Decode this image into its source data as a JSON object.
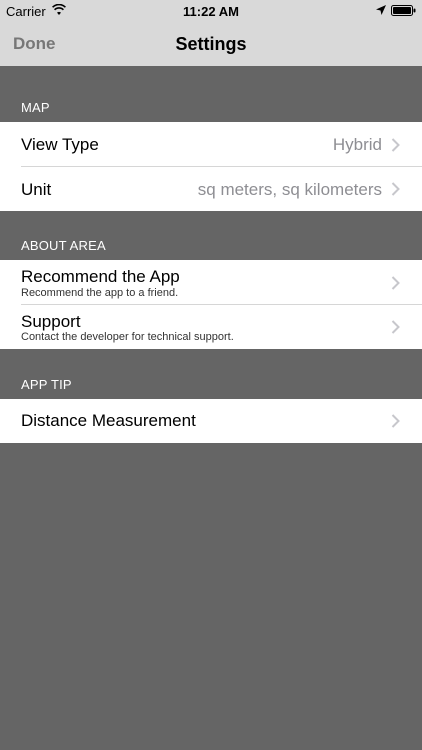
{
  "status_bar": {
    "carrier": "Carrier",
    "time": "11:22 AM"
  },
  "nav": {
    "done_label": "Done",
    "title": "Settings"
  },
  "sections": {
    "map": {
      "header": "MAP",
      "view_type": {
        "label": "View Type",
        "value": "Hybrid"
      },
      "unit": {
        "label": "Unit",
        "value": "sq meters, sq kilometers"
      }
    },
    "about": {
      "header": "ABOUT AREA",
      "recommend": {
        "label": "Recommend the App",
        "subtitle": "Recommend the app to a friend."
      },
      "support": {
        "label": "Support",
        "subtitle": "Contact the developer for technical support."
      }
    },
    "tip": {
      "header": "APP TIP",
      "distance": {
        "label": "Distance Measurement"
      }
    }
  },
  "colors": {
    "background": "#656565",
    "bar": "#d9d9d9",
    "cell": "#ffffff",
    "value_text": "#8e8e93"
  }
}
